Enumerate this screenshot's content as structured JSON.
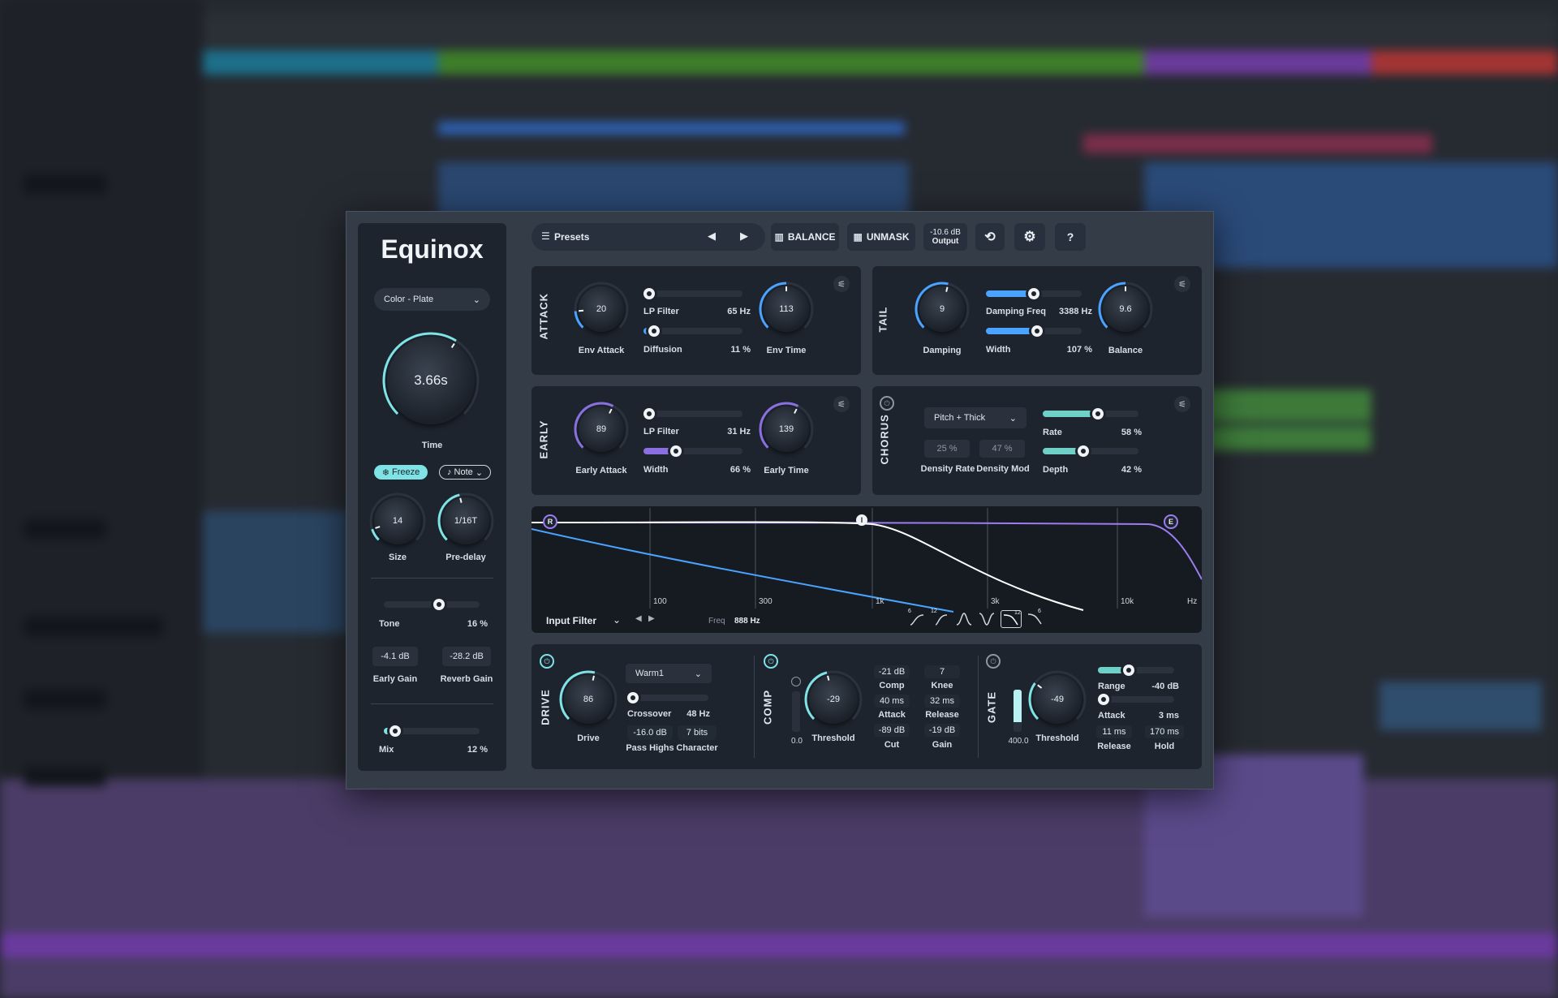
{
  "background": {
    "description_blocks": true
  },
  "plugin": {
    "title": "Equinox",
    "preset_type": "Color - Plate",
    "time": {
      "value": "3.66s",
      "label": "Time",
      "fraction": 0.62
    },
    "freeze_label": "Freeze",
    "note_label": "Note",
    "size": {
      "value": "14",
      "label": "Size",
      "fraction": 0.1
    },
    "predelay": {
      "value": "1/16T",
      "label": "Pre-delay",
      "fraction": 0.45
    },
    "tone": {
      "label": "Tone",
      "value": "16 %",
      "fraction": 0.58
    },
    "early_gain": {
      "value": "-4.1 dB",
      "label": "Early Gain"
    },
    "reverb_gain": {
      "value": "-28.2 dB",
      "label": "Reverb Gain"
    },
    "mix": {
      "label": "Mix",
      "value": "12 %",
      "fraction": 0.12
    }
  },
  "toolbar": {
    "presets_label": "Presets",
    "balance_label": "BALANCE",
    "unmask_label": "UNMASK",
    "output_value": "-10.6 dB",
    "output_label": "Output",
    "help_label": "?"
  },
  "attack": {
    "section": "ATTACK",
    "env_attack": {
      "value": "20",
      "label": "Env Attack",
      "fraction": 0.15
    },
    "lp_filter": {
      "label": "LP Filter",
      "value": "65 Hz",
      "fraction": 0.05
    },
    "diffusion": {
      "label": "Diffusion",
      "value": "11 %",
      "fraction": 0.11
    },
    "env_time": {
      "value": "113",
      "label": "Env Time",
      "fraction": 0.5
    }
  },
  "tail": {
    "section": "TAIL",
    "damping": {
      "value": "9",
      "label": "Damping",
      "fraction": 0.55
    },
    "damping_freq": {
      "label": "Damping Freq",
      "value": "3388 Hz",
      "fraction": 0.5
    },
    "width": {
      "label": "Width",
      "value": "107 %",
      "fraction": 0.53
    },
    "balance": {
      "value": "9.6",
      "label": "Balance",
      "fraction": 0.5
    }
  },
  "early": {
    "section": "EARLY",
    "early_attack": {
      "value": "89",
      "label": "Early Attack",
      "fraction": 0.6
    },
    "lp_filter": {
      "label": "LP Filter",
      "value": "31 Hz",
      "fraction": 0.02
    },
    "width": {
      "label": "Width",
      "value": "66 %",
      "fraction": 0.33
    },
    "early_time": {
      "value": "139",
      "label": "Early Time",
      "fraction": 0.6
    }
  },
  "chorus": {
    "section": "CHORUS",
    "mode": "Pitch + Thick",
    "density_rate": {
      "value": "25 %",
      "label": "Density Rate"
    },
    "density_mod": {
      "value": "47 %",
      "label": "Density Mod"
    },
    "rate": {
      "label": "Rate",
      "value": "58 %",
      "fraction": 0.58
    },
    "depth": {
      "label": "Depth",
      "value": "42 %",
      "fraction": 0.42
    }
  },
  "filter": {
    "name": "Input Filter",
    "freq_label": "Freq",
    "freq_value": "888 Hz",
    "ticks": [
      "100",
      "300",
      "1k",
      "3k",
      "10k",
      "Hz"
    ],
    "node_labels": [
      "R",
      "I",
      "E"
    ],
    "shape_labels": [
      "6",
      "12",
      "12",
      "6"
    ]
  },
  "drive": {
    "section": "DRIVE",
    "drive": {
      "value": "86",
      "label": "Drive",
      "fraction": 0.55
    },
    "model": "Warm1",
    "crossover": {
      "label": "Crossover",
      "value": "48 Hz",
      "fraction": 0.02
    },
    "pass_highs": {
      "value": "-16.0 dB",
      "label": "Pass Highs"
    },
    "character": {
      "value": "7 bits",
      "label": "Character"
    }
  },
  "comp": {
    "section": "COMP",
    "meter_value": "0.0",
    "threshold": {
      "value": "-29",
      "label": "Threshold",
      "fraction": 0.45
    },
    "comp": {
      "value": "-21 dB",
      "label": "Comp"
    },
    "knee": {
      "value": "7",
      "label": "Knee"
    },
    "attack": {
      "value": "40 ms",
      "label": "Attack"
    },
    "release": {
      "value": "32 ms",
      "label": "Release"
    },
    "cut": {
      "value": "-89 dB",
      "label": "Cut"
    },
    "gain": {
      "value": "-19 dB",
      "label": "Gain"
    }
  },
  "gate": {
    "section": "GATE",
    "meter_value": "400.0",
    "threshold": {
      "value": "-49",
      "label": "Threshold",
      "fraction": 0.3
    },
    "range": {
      "label": "Range",
      "value": "-40 dB",
      "fraction": 0.4
    },
    "attack": {
      "label": "Attack",
      "value": "3 ms",
      "fraction": 0.02
    },
    "release": {
      "value": "11 ms",
      "label": "Release"
    },
    "hold": {
      "value": "170 ms",
      "label": "Hold"
    }
  },
  "colors": {
    "accent_teal": "#7fe3e6",
    "accent_purple": "#8a6fe0",
    "accent_blue": "#4aa3ff",
    "panel": "#1d242e",
    "frame": "#343c48"
  }
}
